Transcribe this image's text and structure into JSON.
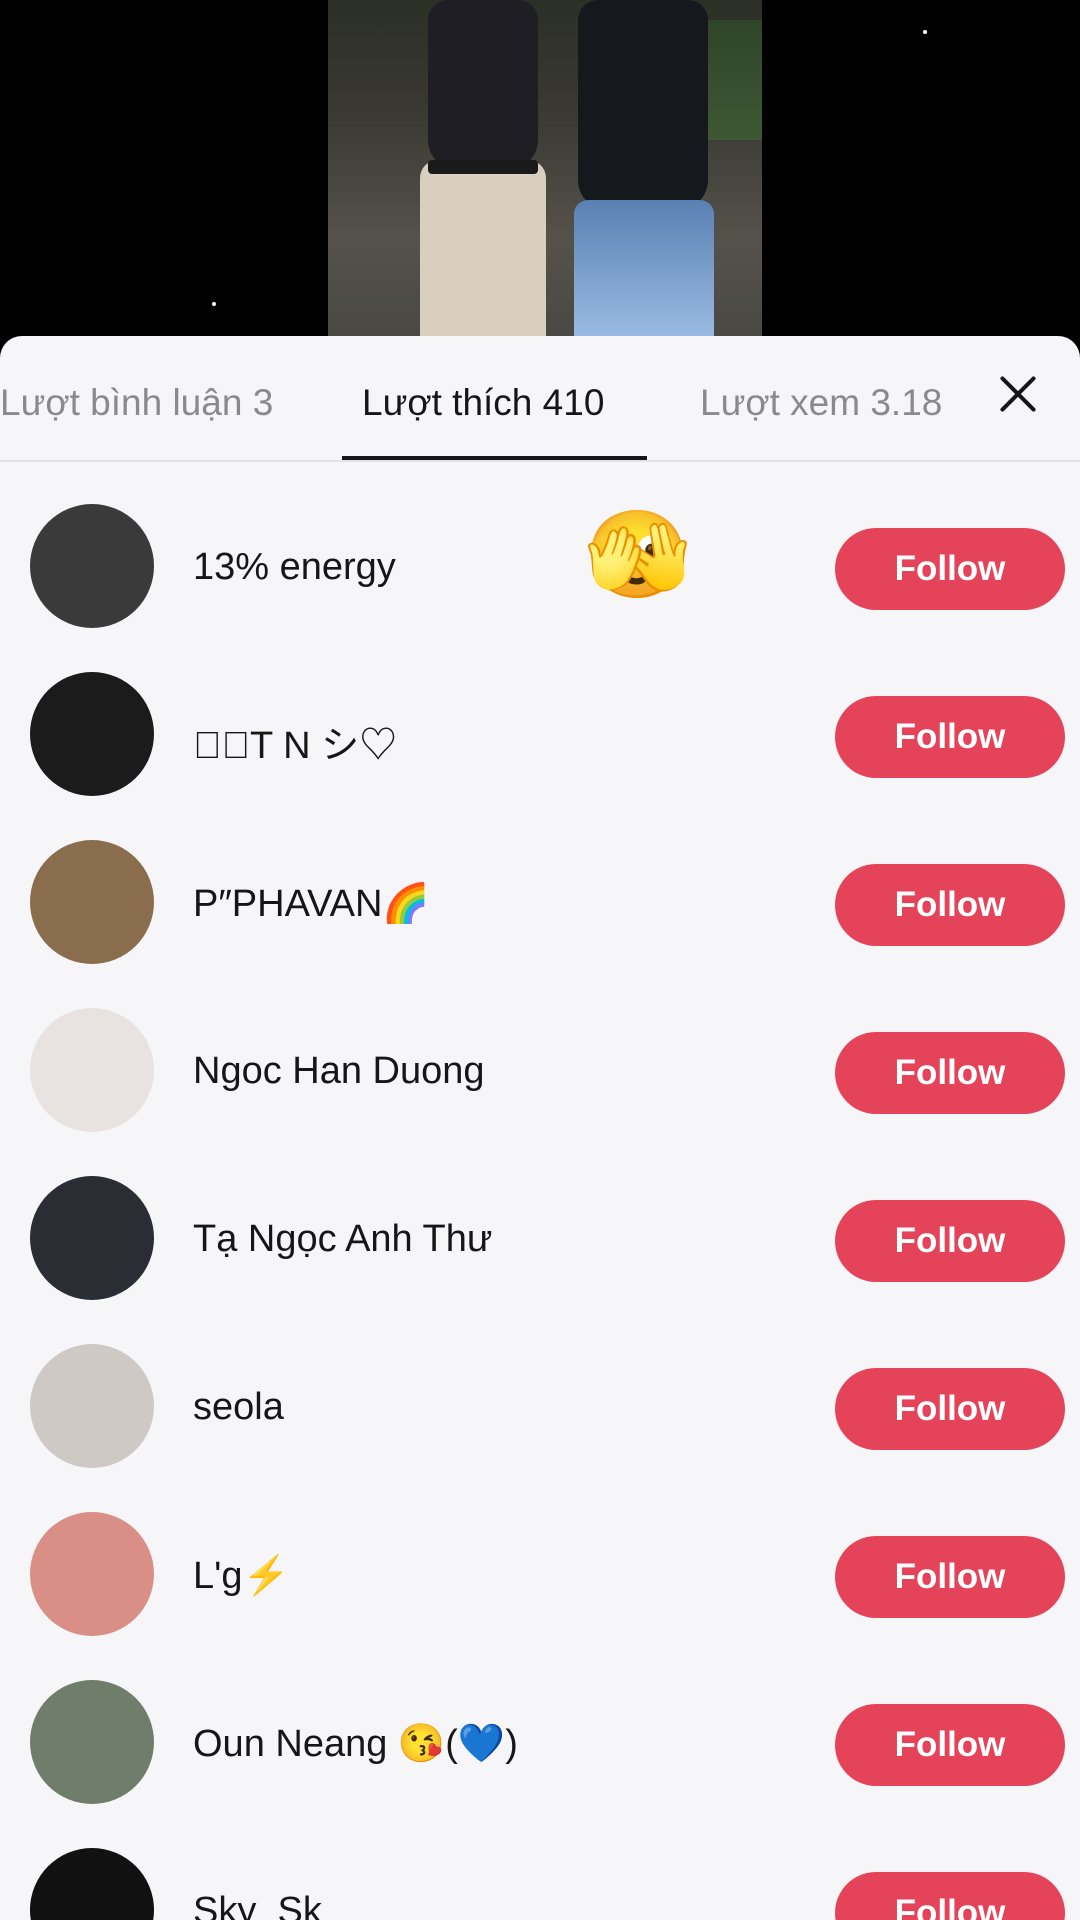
{
  "tabs": {
    "comments": "Lượt bình luận 3",
    "likes": "Lượt thích 410",
    "views": "Lượt xem 3.18"
  },
  "reaction_emoji": "🫣",
  "follow_label": "Follow",
  "users": [
    {
      "name": "13% energy",
      "avatar_bg": "#3a3a3a"
    },
    {
      "name": "⋆๊T N シ♡",
      "avatar_bg": "#1b1b1b"
    },
    {
      "name": "P″PHAVAN🌈",
      "avatar_bg": "#8a6d4d"
    },
    {
      "name": "Ngoc Han Duong",
      "avatar_bg": "#e8e3e1"
    },
    {
      "name": "Tạ Ngọc Anh Thư",
      "avatar_bg": "#2a2d33"
    },
    {
      "name": "seola",
      "avatar_bg": "#cfc9c6"
    },
    {
      "name": "L'g⚡️",
      "avatar_bg": "#d98f86"
    },
    {
      "name": "Oun Neang 😘(💙)",
      "avatar_bg": "#6f7d6a"
    },
    {
      "name": "Sky_Sk",
      "avatar_bg": "#111111"
    }
  ]
}
